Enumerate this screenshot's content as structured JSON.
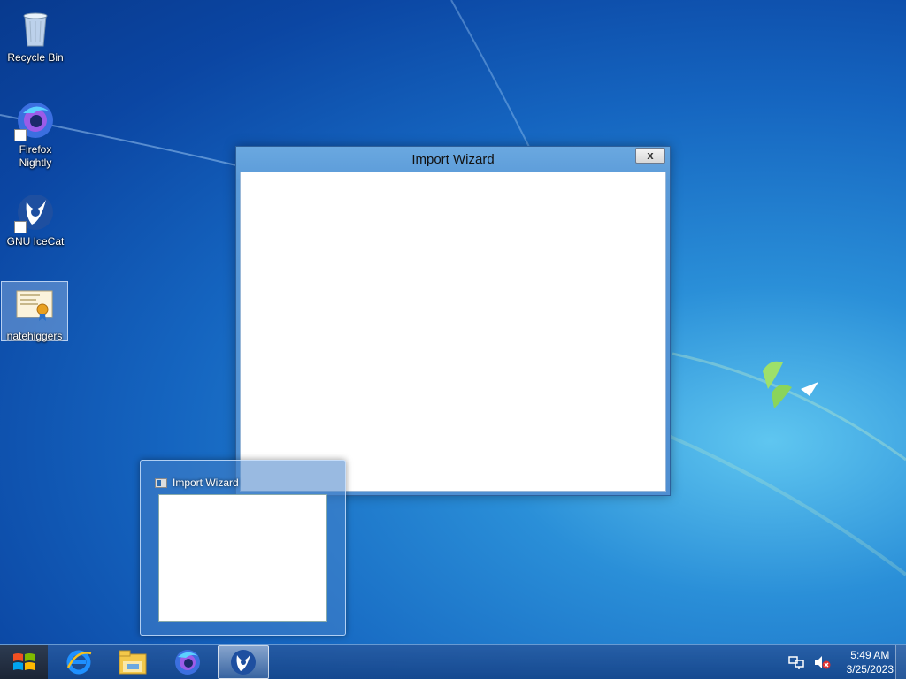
{
  "desktop": {
    "icons": [
      {
        "label": "Recycle Bin",
        "icon": "recycle-bin-icon"
      },
      {
        "label": "Firefox Nightly",
        "icon": "firefox-nightly-icon"
      },
      {
        "label": "GNU IceCat",
        "icon": "gnu-icecat-icon"
      },
      {
        "label": "natehiggers",
        "icon": "certificate-file-icon"
      }
    ]
  },
  "window": {
    "title": "Import Wizard",
    "close_label": "x"
  },
  "preview": {
    "title": "Import Wizard"
  },
  "taskbar": {
    "start_icon": "windows-logo-icon",
    "pinned": [
      "internet-explorer-icon",
      "file-explorer-icon",
      "firefox-nightly-icon",
      "gnu-icecat-icon"
    ],
    "tray": {
      "network_icon": "network-icon",
      "volume_icon": "volume-muted-icon",
      "time": "5:49 AM",
      "date": "3/25/2023"
    }
  },
  "colors": {
    "window_frame": "#5a9ad8",
    "desktop_blue": "#1565c0"
  }
}
